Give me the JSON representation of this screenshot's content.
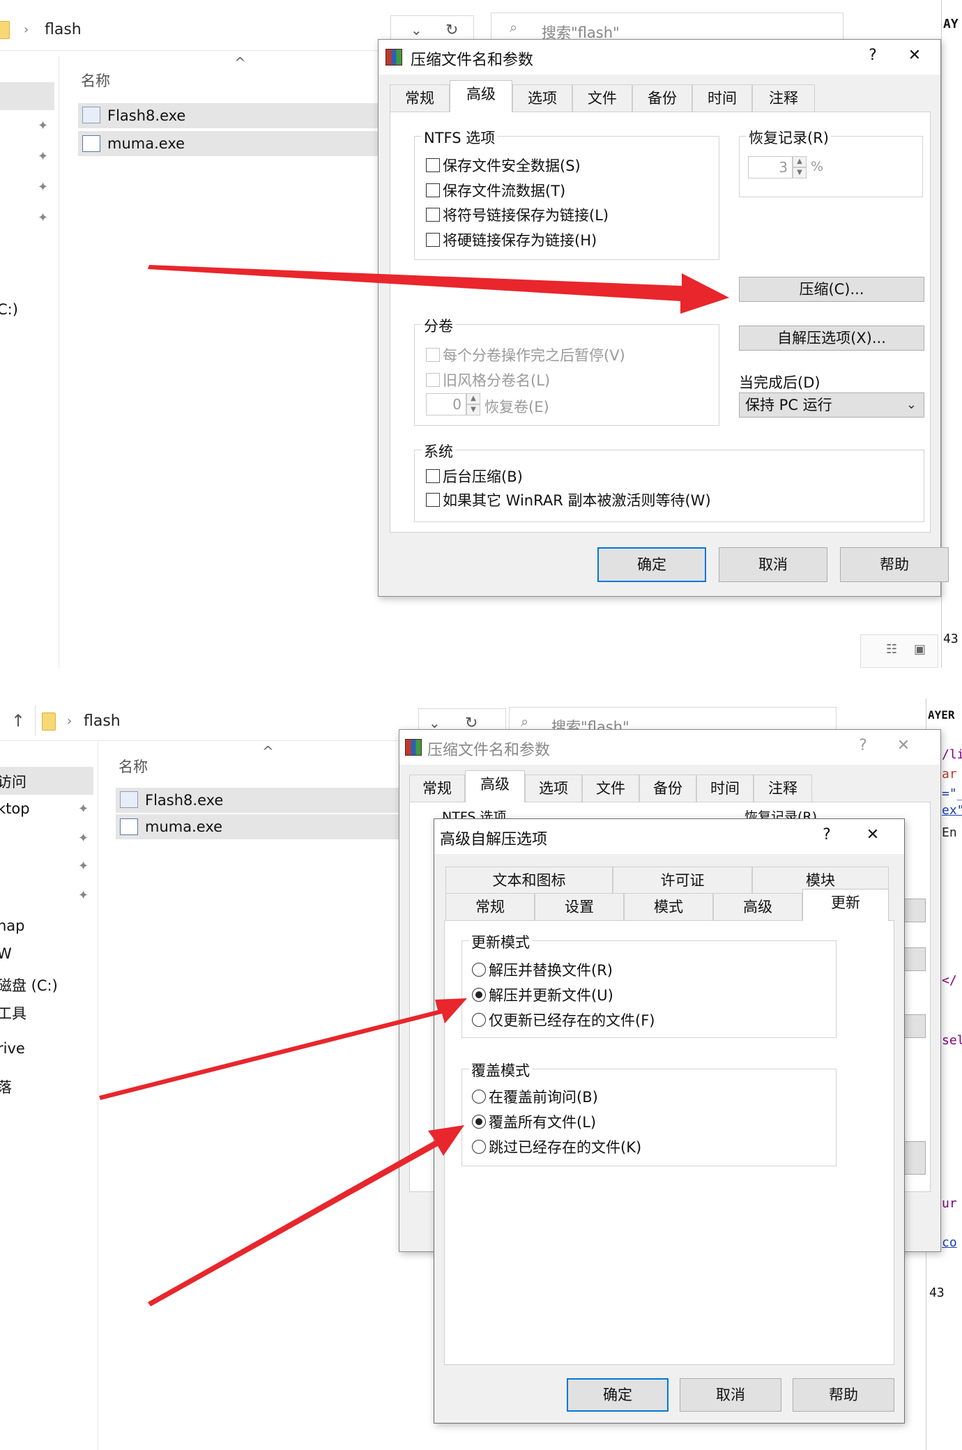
{
  "colors": {
    "accent": "#0078d7",
    "arrow": "#e8262c",
    "dialog_bg": "#f0f0f0",
    "selected_row": "#e5e5e5"
  },
  "top": {
    "explorer": {
      "breadcrumb": "flash",
      "search_placeholder": "搜索\"flash\"",
      "column_name": "名称",
      "files": [
        "Flash8.exe",
        "muma.exe"
      ],
      "side_partial": "C:)"
    },
    "right_code": {
      "header": "AY",
      "status_number": "43"
    },
    "dialog": {
      "title": "压缩文件名和参数",
      "help_glyph": "?",
      "close_glyph": "✕",
      "tabs": [
        "常规",
        "高级",
        "选项",
        "文件",
        "备份",
        "时间",
        "注释"
      ],
      "ntfs": {
        "title": "NTFS 选项",
        "options": [
          "保存文件安全数据(S)",
          "保存文件流数据(T)",
          "将符号链接保存为链接(L)",
          "将硬链接保存为链接(H)"
        ]
      },
      "recovery": {
        "title": "恢复记录(R)",
        "value": "3",
        "unit": "%"
      },
      "compress_button": "压缩(C)...",
      "sfx_button": "自解压选项(X)...",
      "volumes": {
        "title": "分卷",
        "options": [
          "每个分卷操作完之后暂停(V)",
          "旧风格分卷名(L)"
        ],
        "recovery_volumes_value": "0",
        "recovery_volumes_label": "恢复卷(E)"
      },
      "after_done": {
        "label": "当完成后(D)",
        "value": "保持 PC 运行"
      },
      "system": {
        "title": "系统",
        "options": [
          "后台压缩(B)",
          "如果其它 WinRAR 副本被激活则等待(W)"
        ]
      },
      "buttons": {
        "ok": "确定",
        "cancel": "取消",
        "help": "帮助"
      }
    }
  },
  "bottom": {
    "explorer": {
      "breadcrumb": "flash",
      "search_placeholder": "搜索\"flash\"",
      "column_name": "名称",
      "files": [
        "Flash8.exe",
        "muma.exe"
      ],
      "sidebar": [
        "访问",
        "ktop",
        "nap",
        "W",
        "磁盘 (C:)",
        "工具",
        "rive",
        "落"
      ]
    },
    "right_code": {
      "header": "AYER",
      "status_number": "43",
      "lines": [
        "/li",
        "ar",
        "=\"_",
        "ex\"",
        "En",
        "</",
        "sel",
        "ur",
        "co"
      ]
    },
    "back_dialog": {
      "title": "压缩文件名和参数",
      "help_glyph": "?",
      "close_glyph": "✕",
      "tabs": [
        "常规",
        "高级",
        "选项",
        "文件",
        "备份",
        "时间",
        "注释"
      ],
      "partial_labels": [
        "NTFS 选项",
        "恢复记录(R)"
      ]
    },
    "sfx_dialog": {
      "title": "高级自解压选项",
      "help_glyph": "?",
      "close_glyph": "✕",
      "tabs_row1": [
        "文本和图标",
        "许可证",
        "模块"
      ],
      "tabs_row2": [
        "常规",
        "设置",
        "模式",
        "高级",
        "更新"
      ],
      "update_mode": {
        "title": "更新模式",
        "options": [
          "解压并替换文件(R)",
          "解压并更新文件(U)",
          "仅更新已经存在的文件(F)"
        ],
        "selected": 1
      },
      "overwrite_mode": {
        "title": "覆盖模式",
        "options": [
          "在覆盖前询问(B)",
          "覆盖所有文件(L)",
          "跳过已经存在的文件(K)"
        ],
        "selected": 1
      },
      "buttons": {
        "ok": "确定",
        "cancel": "取消",
        "help": "帮助"
      }
    }
  }
}
